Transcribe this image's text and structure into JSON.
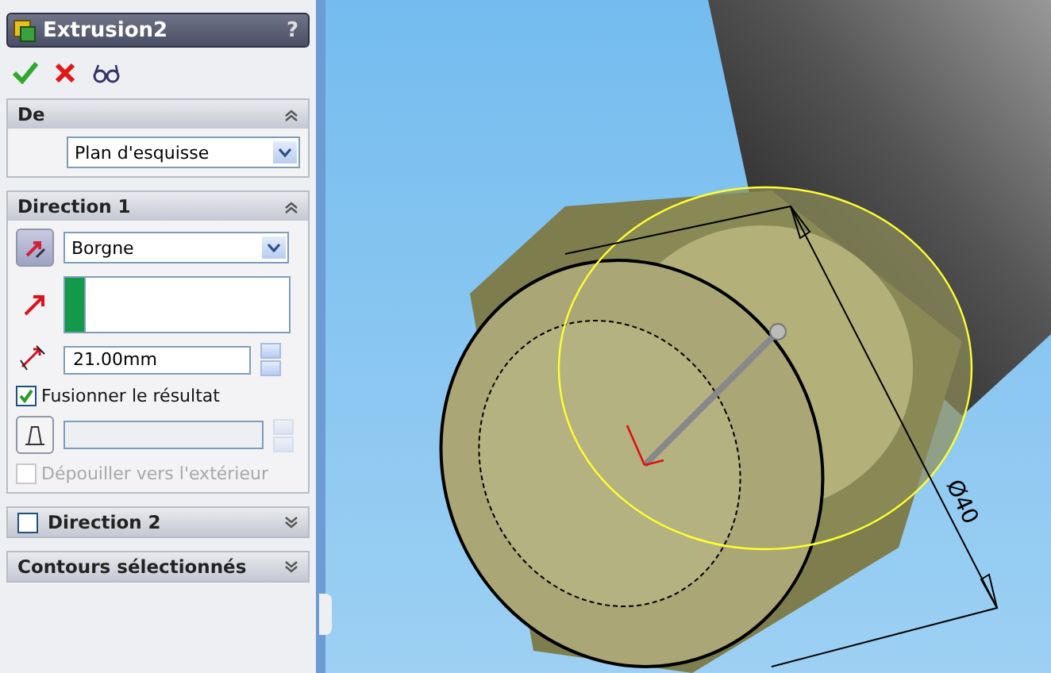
{
  "title": "Extrusion2",
  "help": "?",
  "sections": [
    {
      "kind": "from",
      "title": "De",
      "expanded": true,
      "select": "Plan d'esquisse"
    },
    {
      "kind": "direction",
      "title": "Direction 1",
      "expanded": true,
      "end_condition": "Borgne",
      "depth": "21.00mm",
      "merge": {
        "label": "Fusionner le résultat",
        "checked": true
      },
      "draft": {
        "label": "Dépouiller vers l'extérieur",
        "checked": false,
        "disabled": true
      }
    },
    {
      "kind": "optional",
      "title": "Direction 2",
      "checked": false,
      "expanded": false
    },
    {
      "kind": "plain",
      "title": "Contours sélectionnés",
      "expanded": false
    }
  ],
  "dimension": "Ø40"
}
